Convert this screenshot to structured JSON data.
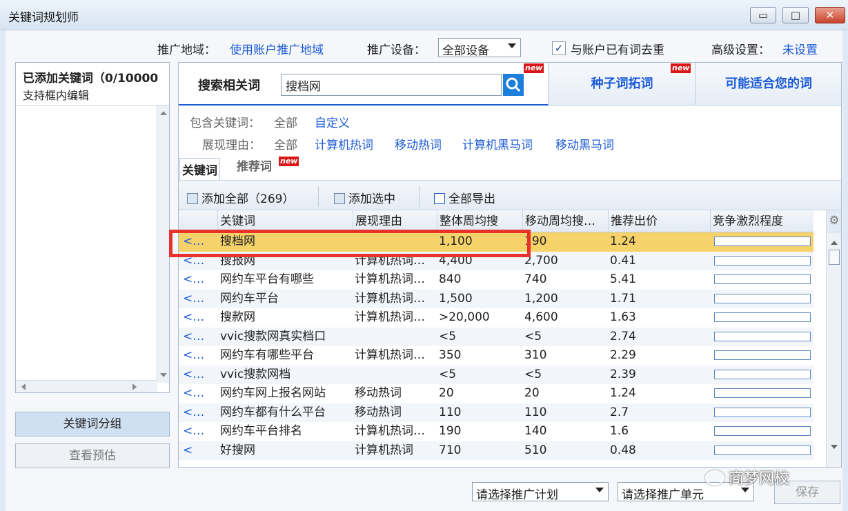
{
  "window": {
    "title": "关键词规划师",
    "min": "▭",
    "max": "□",
    "close": "✕"
  },
  "settings": {
    "region_label": "推广地域：",
    "region_value": "使用账户推广地域",
    "device_label": "推广设备：",
    "device_value": "全部设备",
    "dedupe_checked": "✓",
    "dedupe_label": "与账户已有词去重",
    "advanced_label": "高级设置：",
    "advanced_value": "未设置"
  },
  "left": {
    "title": "已添加关键词（0/10000",
    "subtitle": "支持框内编辑",
    "group_button": "关键词分组",
    "preview_button": "查看预估"
  },
  "tabs": {
    "search_label": "搜索相关词",
    "search_value": "搜档网",
    "seed": "种子词拓词",
    "suggest": "可能适合您的词",
    "new": "new"
  },
  "filters": {
    "include_label": "包含关键词：",
    "include_all": "全部",
    "include_custom": "自定义",
    "reason_label": "展现理由：",
    "reason_all": "全部",
    "reason_options": [
      "计算机热词",
      "移动热词",
      "计算机黑马词",
      "移动黑马词"
    ]
  },
  "subtabs": {
    "keywords": "关键词",
    "recommended": "推荐词",
    "new": "new"
  },
  "toolbar": {
    "add_all": "添加全部（269）",
    "add_selected": "添加选中",
    "export_all": "全部导出"
  },
  "table": {
    "columns": [
      "关键词",
      "展现理由",
      "整体周均搜",
      "移动周均搜…",
      "推荐出价",
      "竞争激烈程度"
    ],
    "rows": [
      {
        "act": "<…",
        "kw": "搜档网",
        "reason": "",
        "total": "1,100",
        "mobile": "190",
        "bid": "1.24",
        "comp": 0.0
      },
      {
        "act": "<…",
        "kw": "搜报网",
        "reason": "计算机热词…",
        "total": "4,400",
        "mobile": "2,700",
        "bid": "0.41",
        "comp": 0.0
      },
      {
        "act": "<…",
        "kw": "网约车平台有哪些",
        "reason": "计算机热词…",
        "total": "840",
        "mobile": "740",
        "bid": "5.41",
        "comp": 0.0
      },
      {
        "act": "<…",
        "kw": "网约车平台",
        "reason": "计算机热词…",
        "total": "1,500",
        "mobile": "1,200",
        "bid": "1.71",
        "comp": 0.0
      },
      {
        "act": "<…",
        "kw": "搜款网",
        "reason": "计算机热词…",
        "total": ">20,000",
        "mobile": "4,600",
        "bid": "1.63",
        "comp": 0.0
      },
      {
        "act": "<…",
        "kw": "vvic搜款网真实档口",
        "reason": "",
        "total": "<5",
        "mobile": "<5",
        "bid": "2.74",
        "comp": 0.0
      },
      {
        "act": "<…",
        "kw": "网约车有哪些平台",
        "reason": "计算机热词…",
        "total": "350",
        "mobile": "310",
        "bid": "2.29",
        "comp": 0.0
      },
      {
        "act": "<…",
        "kw": "vvic搜款网档",
        "reason": "",
        "total": "<5",
        "mobile": "<5",
        "bid": "2.39",
        "comp": 0.0
      },
      {
        "act": "<…",
        "kw": "网约车网上报名网站",
        "reason": "移动热词",
        "total": "20",
        "mobile": "20",
        "bid": "1.24",
        "comp": 0.0
      },
      {
        "act": "<…",
        "kw": "网约车都有什么平台",
        "reason": "移动热词",
        "total": "110",
        "mobile": "110",
        "bid": "2.7",
        "comp": 0.0
      },
      {
        "act": "<…",
        "kw": "网约车平台排名",
        "reason": "计算机热词…",
        "total": "190",
        "mobile": "140",
        "bid": "1.6",
        "comp": 0.0
      },
      {
        "act": "<",
        "kw": "好搜网",
        "reason": "计算机热词",
        "total": "710",
        "mobile": "510",
        "bid": "0.48",
        "comp": 0.0
      }
    ]
  },
  "bottom": {
    "plan_select": "请选择推广计划",
    "unit_select": "请选择推广单元",
    "save": "保存",
    "watermark": "商梦网校"
  },
  "colors": {
    "link": "#1c5bd6",
    "highlight_row": "#f6d36a",
    "highlight_box": "#e8322c"
  }
}
